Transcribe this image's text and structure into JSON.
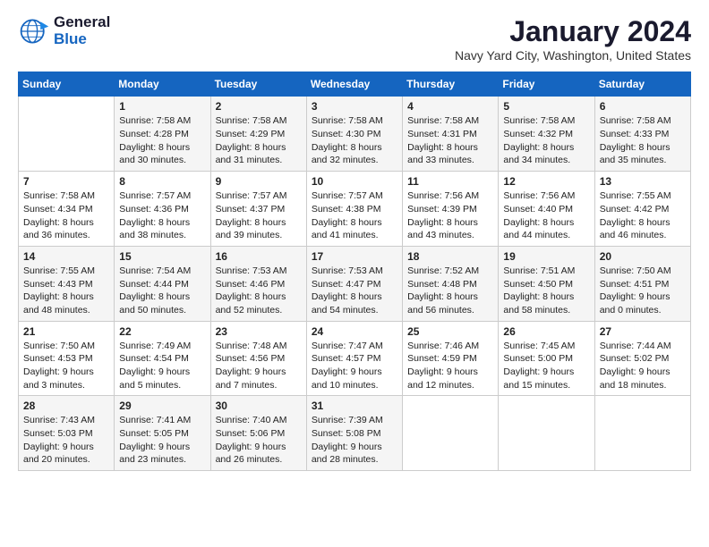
{
  "header": {
    "logo_line1": "General",
    "logo_line2": "Blue",
    "title": "January 2024",
    "subtitle": "Navy Yard City, Washington, United States"
  },
  "days_of_week": [
    "Sunday",
    "Monday",
    "Tuesday",
    "Wednesday",
    "Thursday",
    "Friday",
    "Saturday"
  ],
  "weeks": [
    [
      {
        "day": "",
        "sunrise": "",
        "sunset": "",
        "daylight": ""
      },
      {
        "day": "1",
        "sunrise": "Sunrise: 7:58 AM",
        "sunset": "Sunset: 4:28 PM",
        "daylight": "Daylight: 8 hours and 30 minutes."
      },
      {
        "day": "2",
        "sunrise": "Sunrise: 7:58 AM",
        "sunset": "Sunset: 4:29 PM",
        "daylight": "Daylight: 8 hours and 31 minutes."
      },
      {
        "day": "3",
        "sunrise": "Sunrise: 7:58 AM",
        "sunset": "Sunset: 4:30 PM",
        "daylight": "Daylight: 8 hours and 32 minutes."
      },
      {
        "day": "4",
        "sunrise": "Sunrise: 7:58 AM",
        "sunset": "Sunset: 4:31 PM",
        "daylight": "Daylight: 8 hours and 33 minutes."
      },
      {
        "day": "5",
        "sunrise": "Sunrise: 7:58 AM",
        "sunset": "Sunset: 4:32 PM",
        "daylight": "Daylight: 8 hours and 34 minutes."
      },
      {
        "day": "6",
        "sunrise": "Sunrise: 7:58 AM",
        "sunset": "Sunset: 4:33 PM",
        "daylight": "Daylight: 8 hours and 35 minutes."
      }
    ],
    [
      {
        "day": "7",
        "sunrise": "Sunrise: 7:58 AM",
        "sunset": "Sunset: 4:34 PM",
        "daylight": "Daylight: 8 hours and 36 minutes."
      },
      {
        "day": "8",
        "sunrise": "Sunrise: 7:57 AM",
        "sunset": "Sunset: 4:36 PM",
        "daylight": "Daylight: 8 hours and 38 minutes."
      },
      {
        "day": "9",
        "sunrise": "Sunrise: 7:57 AM",
        "sunset": "Sunset: 4:37 PM",
        "daylight": "Daylight: 8 hours and 39 minutes."
      },
      {
        "day": "10",
        "sunrise": "Sunrise: 7:57 AM",
        "sunset": "Sunset: 4:38 PM",
        "daylight": "Daylight: 8 hours and 41 minutes."
      },
      {
        "day": "11",
        "sunrise": "Sunrise: 7:56 AM",
        "sunset": "Sunset: 4:39 PM",
        "daylight": "Daylight: 8 hours and 43 minutes."
      },
      {
        "day": "12",
        "sunrise": "Sunrise: 7:56 AM",
        "sunset": "Sunset: 4:40 PM",
        "daylight": "Daylight: 8 hours and 44 minutes."
      },
      {
        "day": "13",
        "sunrise": "Sunrise: 7:55 AM",
        "sunset": "Sunset: 4:42 PM",
        "daylight": "Daylight: 8 hours and 46 minutes."
      }
    ],
    [
      {
        "day": "14",
        "sunrise": "Sunrise: 7:55 AM",
        "sunset": "Sunset: 4:43 PM",
        "daylight": "Daylight: 8 hours and 48 minutes."
      },
      {
        "day": "15",
        "sunrise": "Sunrise: 7:54 AM",
        "sunset": "Sunset: 4:44 PM",
        "daylight": "Daylight: 8 hours and 50 minutes."
      },
      {
        "day": "16",
        "sunrise": "Sunrise: 7:53 AM",
        "sunset": "Sunset: 4:46 PM",
        "daylight": "Daylight: 8 hours and 52 minutes."
      },
      {
        "day": "17",
        "sunrise": "Sunrise: 7:53 AM",
        "sunset": "Sunset: 4:47 PM",
        "daylight": "Daylight: 8 hours and 54 minutes."
      },
      {
        "day": "18",
        "sunrise": "Sunrise: 7:52 AM",
        "sunset": "Sunset: 4:48 PM",
        "daylight": "Daylight: 8 hours and 56 minutes."
      },
      {
        "day": "19",
        "sunrise": "Sunrise: 7:51 AM",
        "sunset": "Sunset: 4:50 PM",
        "daylight": "Daylight: 8 hours and 58 minutes."
      },
      {
        "day": "20",
        "sunrise": "Sunrise: 7:50 AM",
        "sunset": "Sunset: 4:51 PM",
        "daylight": "Daylight: 9 hours and 0 minutes."
      }
    ],
    [
      {
        "day": "21",
        "sunrise": "Sunrise: 7:50 AM",
        "sunset": "Sunset: 4:53 PM",
        "daylight": "Daylight: 9 hours and 3 minutes."
      },
      {
        "day": "22",
        "sunrise": "Sunrise: 7:49 AM",
        "sunset": "Sunset: 4:54 PM",
        "daylight": "Daylight: 9 hours and 5 minutes."
      },
      {
        "day": "23",
        "sunrise": "Sunrise: 7:48 AM",
        "sunset": "Sunset: 4:56 PM",
        "daylight": "Daylight: 9 hours and 7 minutes."
      },
      {
        "day": "24",
        "sunrise": "Sunrise: 7:47 AM",
        "sunset": "Sunset: 4:57 PM",
        "daylight": "Daylight: 9 hours and 10 minutes."
      },
      {
        "day": "25",
        "sunrise": "Sunrise: 7:46 AM",
        "sunset": "Sunset: 4:59 PM",
        "daylight": "Daylight: 9 hours and 12 minutes."
      },
      {
        "day": "26",
        "sunrise": "Sunrise: 7:45 AM",
        "sunset": "Sunset: 5:00 PM",
        "daylight": "Daylight: 9 hours and 15 minutes."
      },
      {
        "day": "27",
        "sunrise": "Sunrise: 7:44 AM",
        "sunset": "Sunset: 5:02 PM",
        "daylight": "Daylight: 9 hours and 18 minutes."
      }
    ],
    [
      {
        "day": "28",
        "sunrise": "Sunrise: 7:43 AM",
        "sunset": "Sunset: 5:03 PM",
        "daylight": "Daylight: 9 hours and 20 minutes."
      },
      {
        "day": "29",
        "sunrise": "Sunrise: 7:41 AM",
        "sunset": "Sunset: 5:05 PM",
        "daylight": "Daylight: 9 hours and 23 minutes."
      },
      {
        "day": "30",
        "sunrise": "Sunrise: 7:40 AM",
        "sunset": "Sunset: 5:06 PM",
        "daylight": "Daylight: 9 hours and 26 minutes."
      },
      {
        "day": "31",
        "sunrise": "Sunrise: 7:39 AM",
        "sunset": "Sunset: 5:08 PM",
        "daylight": "Daylight: 9 hours and 28 minutes."
      },
      {
        "day": "",
        "sunrise": "",
        "sunset": "",
        "daylight": ""
      },
      {
        "day": "",
        "sunrise": "",
        "sunset": "",
        "daylight": ""
      },
      {
        "day": "",
        "sunrise": "",
        "sunset": "",
        "daylight": ""
      }
    ]
  ]
}
